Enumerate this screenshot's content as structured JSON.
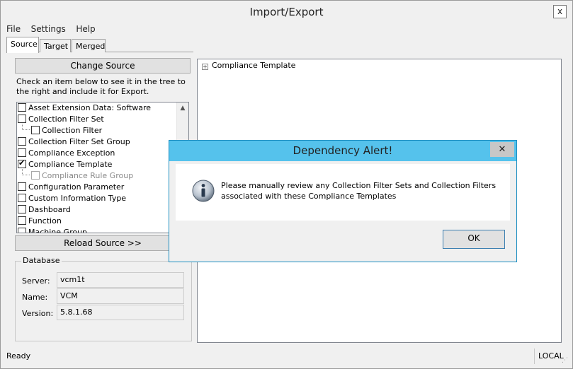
{
  "window": {
    "title": "Import/Export",
    "close_glyph": "x"
  },
  "menu": [
    "File",
    "Settings",
    "Help"
  ],
  "tabs": [
    {
      "label": "Source",
      "active": true
    },
    {
      "label": "Target",
      "active": false
    },
    {
      "label": "Merged",
      "active": false
    }
  ],
  "source": {
    "change_button": "Change Source",
    "instructions": "Check an item below to see it in the tree to the right and include it for Export.",
    "items": [
      {
        "label": "Asset Extension Data: Software",
        "checked": false,
        "indent": 0,
        "enabled": true
      },
      {
        "label": "Collection Filter Set",
        "checked": false,
        "indent": 0,
        "enabled": true
      },
      {
        "label": "Collection Filter",
        "checked": false,
        "indent": 1,
        "enabled": true
      },
      {
        "label": "Collection Filter Set Group",
        "checked": false,
        "indent": 0,
        "enabled": true
      },
      {
        "label": "Compliance Exception",
        "checked": false,
        "indent": 0,
        "enabled": true
      },
      {
        "label": "Compliance Template",
        "checked": true,
        "indent": 0,
        "enabled": true
      },
      {
        "label": "Compliance Rule Group",
        "checked": false,
        "indent": 1,
        "enabled": false
      },
      {
        "label": "Configuration Parameter",
        "checked": false,
        "indent": 0,
        "enabled": true
      },
      {
        "label": "Custom Information Type",
        "checked": false,
        "indent": 0,
        "enabled": true
      },
      {
        "label": "Dashboard",
        "checked": false,
        "indent": 0,
        "enabled": true
      },
      {
        "label": "Function",
        "checked": false,
        "indent": 0,
        "enabled": true
      },
      {
        "label": "Machine Group",
        "checked": false,
        "indent": 0,
        "enabled": true
      }
    ],
    "reload_button": "Reload Source >>"
  },
  "database": {
    "group_title": "Database",
    "server_label": "Server:",
    "server_value": "vcm1t",
    "name_label": "Name:",
    "name_value": "VCM",
    "version_label": "Version:",
    "version_value": "5.8.1.68"
  },
  "tree": {
    "root_label": "Compliance Template",
    "expander_glyph": "+"
  },
  "status": {
    "left": "Ready",
    "right": "LOCAL"
  },
  "dialog": {
    "title": "Dependency Alert!",
    "close_glyph": "✕",
    "message_line1": "Please manually review any Collection Filter Sets and Collection Filters",
    "message_line2": "associated with these Compliance Templates",
    "ok_button": "OK",
    "icon": "info-icon"
  }
}
